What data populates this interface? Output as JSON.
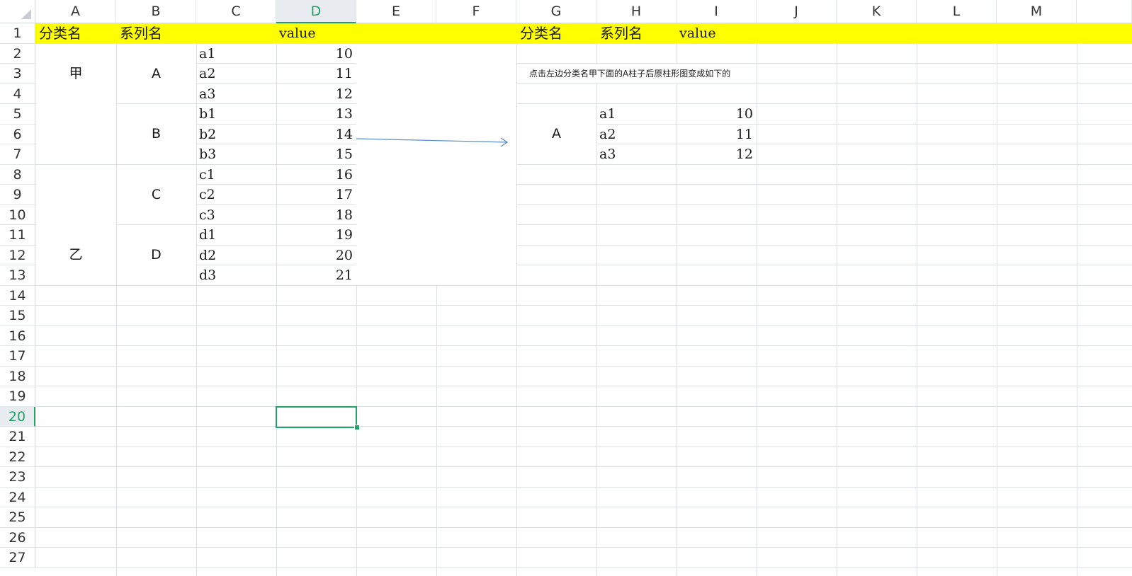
{
  "columns": [
    "A",
    "B",
    "C",
    "D",
    "E",
    "F",
    "G",
    "H",
    "I",
    "J",
    "K",
    "L",
    "M"
  ],
  "rows": [
    "1",
    "2",
    "3",
    "4",
    "5",
    "6",
    "7",
    "8",
    "9",
    "10",
    "11",
    "12",
    "13",
    "14",
    "15",
    "16",
    "17",
    "18",
    "19",
    "20",
    "21",
    "22",
    "23",
    "24",
    "25",
    "26",
    "27"
  ],
  "active_cell": {
    "column": "D",
    "row": "20"
  },
  "header_row": {
    "left": {
      "category": "分类名",
      "series": "系列名",
      "value": "value"
    },
    "right": {
      "category": "分类名",
      "series": "系列名",
      "value": "value"
    }
  },
  "left_table": {
    "categories": [
      "甲",
      "乙"
    ],
    "series": [
      "A",
      "B",
      "C",
      "D"
    ],
    "items": [
      {
        "name": "a1",
        "value": "10"
      },
      {
        "name": "a2",
        "value": "11"
      },
      {
        "name": "a3",
        "value": "12"
      },
      {
        "name": "b1",
        "value": "13"
      },
      {
        "name": "b2",
        "value": "14"
      },
      {
        "name": "b3",
        "value": "15"
      },
      {
        "name": "c1",
        "value": "16"
      },
      {
        "name": "c2",
        "value": "17"
      },
      {
        "name": "c3",
        "value": "18"
      },
      {
        "name": "d1",
        "value": "19"
      },
      {
        "name": "d2",
        "value": "20"
      },
      {
        "name": "d3",
        "value": "21"
      }
    ]
  },
  "note": "点击左边分类名甲下面的A柱子后原柱形图变成如下的",
  "right_table": {
    "series": "A",
    "items": [
      {
        "name": "a1",
        "value": "10"
      },
      {
        "name": "a2",
        "value": "11"
      },
      {
        "name": "a3",
        "value": "12"
      }
    ]
  },
  "colors": {
    "header_fill": "#ffff00",
    "accent": "#21a366",
    "arrow": "#5b8fc7",
    "gridline": "#dde1e6"
  }
}
